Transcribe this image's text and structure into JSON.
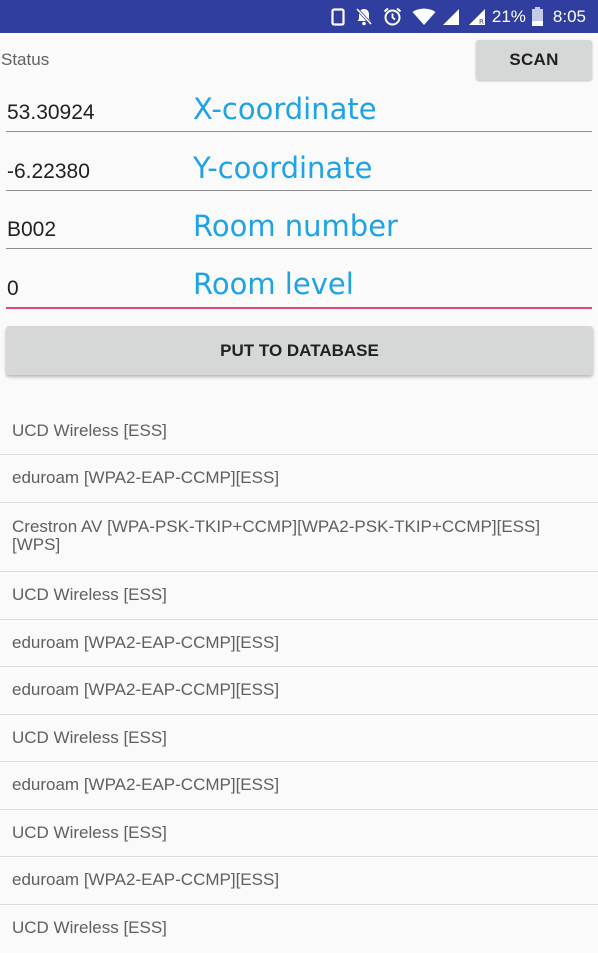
{
  "status_bar": {
    "icons": [
      "vibrate-icon",
      "mute-icon",
      "alarm-icon",
      "wifi-icon",
      "signal-icon",
      "signal-roaming-icon",
      "battery-icon"
    ],
    "battery_percent": "21%",
    "time": "8:05"
  },
  "header": {
    "status_label": "Status",
    "scan_label": "SCAN"
  },
  "fields": [
    {
      "value": "53.30924",
      "annotation": "X-coordinate"
    },
    {
      "value": "-6.22380",
      "annotation": "Y-coordinate"
    },
    {
      "value": "B002",
      "annotation": "Room number"
    },
    {
      "value": "0",
      "annotation": "Room level"
    }
  ],
  "put_button_label": "PUT TO DATABASE",
  "wifi_results": [
    "UCD Wireless  [ESS]",
    "eduroam  [WPA2-EAP-CCMP][ESS]",
    "Crestron AV  [WPA-PSK-TKIP+CCMP][WPA2-PSK-TKIP+CCMP][ESS][WPS]",
    "UCD Wireless  [ESS]",
    "eduroam  [WPA2-EAP-CCMP][ESS]",
    "eduroam  [WPA2-EAP-CCMP][ESS]",
    "UCD Wireless  [ESS]",
    "eduroam  [WPA2-EAP-CCMP][ESS]",
    "UCD Wireless  [ESS]",
    "eduroam  [WPA2-EAP-CCMP][ESS]",
    "UCD Wireless  [ESS]"
  ],
  "colors": {
    "status_bar": "#303f9f",
    "annotation": "#1ea2e8",
    "focus_underline": "#e0457b",
    "button_bg": "#d6d7d7"
  }
}
